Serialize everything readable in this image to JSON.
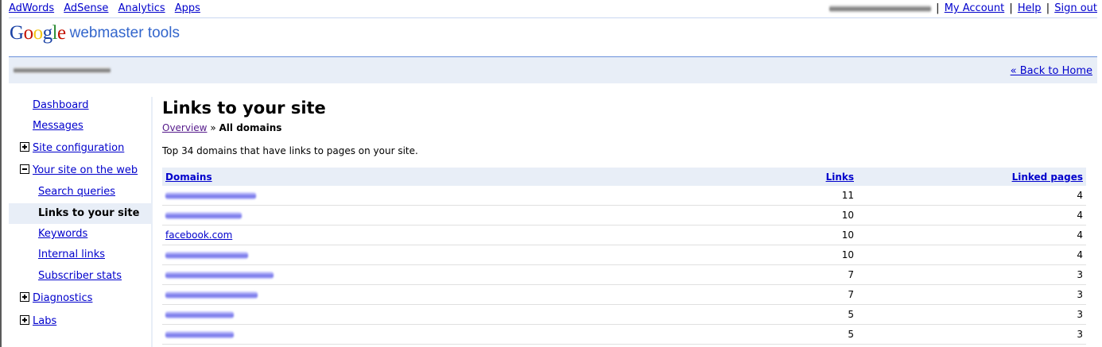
{
  "topbar": {
    "links": [
      "AdWords",
      "AdSense",
      "Analytics",
      "Apps"
    ],
    "my_account": "My Account",
    "help": "Help",
    "sign_out": "Sign out",
    "separator": "|"
  },
  "logo": {
    "text": "webmaster tools",
    "brand_letters": [
      "G",
      "o",
      "o",
      "g",
      "l",
      "e"
    ],
    "brand_colors": [
      "#1941a5",
      "#c41200",
      "#f3c518",
      "#1941a5",
      "#2f8d36",
      "#c41200"
    ]
  },
  "sitebar": {
    "back_link": "« Back to Home"
  },
  "sidebar": {
    "items": [
      {
        "label": "Dashboard"
      },
      {
        "label": "Messages"
      },
      {
        "label": "Site configuration"
      },
      {
        "label": "Your site on the web"
      },
      {
        "label": "Search queries"
      },
      {
        "label": "Links to your site"
      },
      {
        "label": "Keywords"
      },
      {
        "label": "Internal links"
      },
      {
        "label": "Subscriber stats"
      },
      {
        "label": "Diagnostics"
      },
      {
        "label": "Labs"
      }
    ]
  },
  "main": {
    "title": "Links to your site",
    "breadcrumb": {
      "parent": "Overview",
      "separator": "»",
      "current": "All domains"
    },
    "description": "Top 34 domains that have links to pages on your site.",
    "table": {
      "headers": [
        "Domains",
        "Links",
        "Linked pages"
      ],
      "rows": [
        {
          "domain": "",
          "links": "11",
          "pages": "4"
        },
        {
          "domain": "",
          "links": "10",
          "pages": "4"
        },
        {
          "domain": "facebook.com",
          "links": "10",
          "pages": "4"
        },
        {
          "domain": "",
          "links": "10",
          "pages": "4"
        },
        {
          "domain": "",
          "links": "7",
          "pages": "3"
        },
        {
          "domain": "",
          "links": "7",
          "pages": "3"
        },
        {
          "domain": "",
          "links": "5",
          "pages": "3"
        },
        {
          "domain": "",
          "links": "5",
          "pages": "3"
        }
      ]
    }
  },
  "colors": {
    "accent": "#3366cc",
    "link": "#0000cc",
    "header_bg": "#e8eef7"
  }
}
